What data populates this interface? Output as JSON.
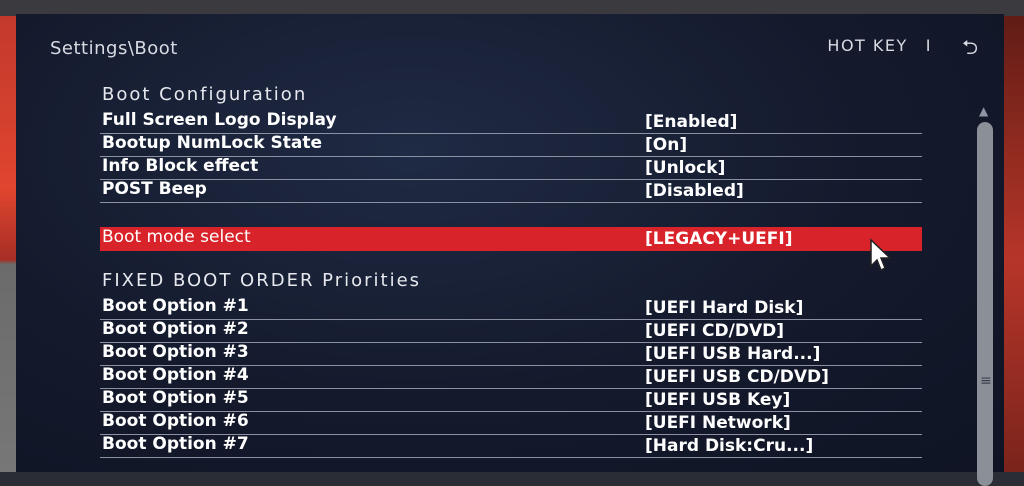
{
  "header": {
    "breadcrumb": "Settings\\Boot",
    "hotkey_label": "HOT KEY",
    "separator": "I",
    "back_icon": "back-arrow-icon"
  },
  "sections": {
    "boot_configuration": "Boot  Configuration",
    "fixed_boot_order": "FIXED  BOOT  ORDER  Priorities"
  },
  "boot_config": [
    {
      "label": "Full Screen Logo Display",
      "value": "[Enabled]"
    },
    {
      "label": "Bootup NumLock State",
      "value": "[On]"
    },
    {
      "label": "Info Block effect",
      "value": "[Unlock]"
    },
    {
      "label": "POST Beep",
      "value": "[Disabled]"
    }
  ],
  "boot_mode": {
    "label": "Boot mode select",
    "value": "[LEGACY+UEFI]",
    "selected": true
  },
  "boot_options": [
    {
      "label": "Boot Option #1",
      "value": "[UEFI Hard Disk]"
    },
    {
      "label": "Boot Option #2",
      "value": "[UEFI CD/DVD]"
    },
    {
      "label": "Boot Option #3",
      "value": "[UEFI USB Hard...]"
    },
    {
      "label": "Boot Option #4",
      "value": "[UEFI USB CD/DVD]"
    },
    {
      "label": "Boot Option #5",
      "value": "[UEFI USB Key]"
    },
    {
      "label": "Boot Option #6",
      "value": "[UEFI Network]"
    },
    {
      "label": "Boot Option #7",
      "value": "[Hard Disk:Cru...]"
    }
  ],
  "colors": {
    "background": "#141a2c",
    "selected_row": "#d8232a",
    "text": "#ffffff",
    "divider": "#8b90a2"
  }
}
